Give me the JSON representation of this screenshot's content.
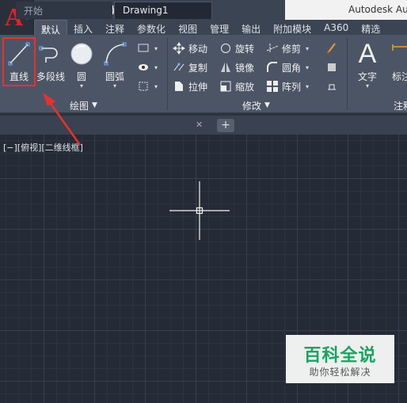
{
  "app": {
    "title": "Autodesk Au",
    "logo_letter": "A"
  },
  "qat": {
    "icons": [
      "new-icon",
      "open-icon",
      "save-icon",
      "saveas-icon",
      "print-icon",
      "undo-icon",
      "redo-icon"
    ]
  },
  "tabs": [
    "默认",
    "插入",
    "注释",
    "参数化",
    "视图",
    "管理",
    "输出",
    "附加模块",
    "A360",
    "精选"
  ],
  "ribbon": {
    "draw": {
      "line": "直线",
      "polyline": "多段线",
      "circle": "圆",
      "arc": "圆弧",
      "panel": "绘图"
    },
    "modify": {
      "move": "移动",
      "rotate": "旋转",
      "trim": "修剪",
      "copy": "复制",
      "mirror": "镜像",
      "fillet": "圆角",
      "stretch": "拉伸",
      "scale": "缩放",
      "array": "阵列",
      "panel": "修改"
    },
    "annotation": {
      "text": "文字",
      "dimension": "标注",
      "panel": "注释"
    }
  },
  "filetabs": {
    "start": "开始",
    "drawing": "Drawing1"
  },
  "viewport": {
    "label": "[−][俯视][二维线框]"
  },
  "watermark": {
    "title": "百科全说",
    "subtitle": "助你轻松解决"
  },
  "colors": {
    "highlight": "#e8312f",
    "watermark": "#1aa361"
  }
}
